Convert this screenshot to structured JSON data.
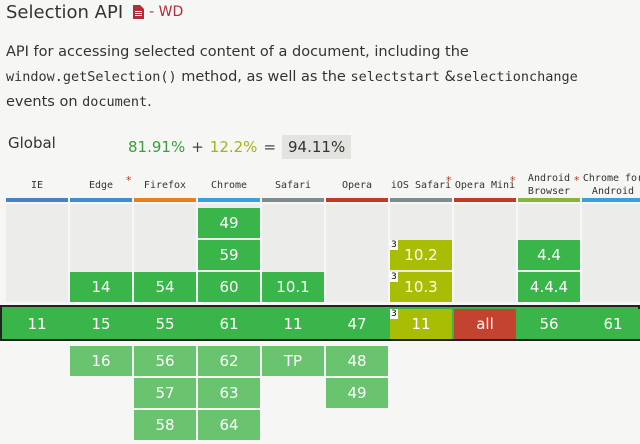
{
  "feature": {
    "title": "Selection API",
    "icon": "document-icon",
    "status": "- WD",
    "description": [
      {
        "text": "API for accessing selected content of a document, including the ",
        "code": false
      },
      {
        "text": "window.getSelection()",
        "code": true
      },
      {
        "text": " method, as well as the ",
        "code": false
      },
      {
        "text": "selectstart",
        "code": true
      },
      {
        "text": " &",
        "code": false
      },
      {
        "text": "selectionchange",
        "code": true
      },
      {
        "text": " events on ",
        "code": false
      },
      {
        "text": "document",
        "code": true
      },
      {
        "text": ".",
        "code": false
      }
    ]
  },
  "global": {
    "label": "Global",
    "full": "81.91%",
    "plus": "+",
    "partial": "12.2%",
    "equals": "=",
    "total": "94.11%"
  },
  "colors": {
    "supported": "#39b54a",
    "supported_future": "#6ac46f",
    "partial": "#a8bd04",
    "unsupported": "#c44230"
  },
  "browsers": [
    {
      "name": "IE",
      "bar": "#4a7fc1",
      "star": false,
      "cells": [
        {
          "row": 3,
          "v": "11",
          "s": "y"
        }
      ]
    },
    {
      "name": "Edge",
      "bar": "#3f8ccf",
      "star": true,
      "cells": [
        {
          "row": 2,
          "v": "14",
          "s": "y"
        },
        {
          "row": 3,
          "v": "15",
          "s": "y"
        },
        {
          "row": 4,
          "v": "16",
          "s": "yf"
        }
      ]
    },
    {
      "name": "Firefox",
      "bar": "#e67e22",
      "star": false,
      "cells": [
        {
          "row": 2,
          "v": "54",
          "s": "y"
        },
        {
          "row": 3,
          "v": "55",
          "s": "y"
        },
        {
          "row": 4,
          "v": "56",
          "s": "yf"
        },
        {
          "row": 5,
          "v": "57",
          "s": "yf"
        },
        {
          "row": 6,
          "v": "58",
          "s": "yf"
        }
      ]
    },
    {
      "name": "Chrome",
      "bar": "#3a9edb",
      "star": false,
      "cells": [
        {
          "row": 0,
          "v": "49",
          "s": "y"
        },
        {
          "row": 1,
          "v": "59",
          "s": "y"
        },
        {
          "row": 2,
          "v": "60",
          "s": "y"
        },
        {
          "row": 3,
          "v": "61",
          "s": "y"
        },
        {
          "row": 4,
          "v": "62",
          "s": "yf"
        },
        {
          "row": 5,
          "v": "63",
          "s": "yf"
        },
        {
          "row": 6,
          "v": "64",
          "s": "yf"
        }
      ]
    },
    {
      "name": "Safari",
      "bar": "#7f8c8d",
      "star": false,
      "cells": [
        {
          "row": 2,
          "v": "10.1",
          "s": "y"
        },
        {
          "row": 3,
          "v": "11",
          "s": "y"
        },
        {
          "row": 4,
          "v": "TP",
          "s": "yf"
        }
      ]
    },
    {
      "name": "Opera",
      "bar": "#c0392b",
      "star": false,
      "cells": [
        {
          "row": 3,
          "v": "47",
          "s": "y"
        },
        {
          "row": 4,
          "v": "48",
          "s": "yf"
        },
        {
          "row": 5,
          "v": "49",
          "s": "yf"
        }
      ]
    },
    {
      "name": "iOS Safari",
      "bar": "#7f8c8d",
      "star": true,
      "cells": [
        {
          "row": 1,
          "v": "10.2",
          "s": "a",
          "note": "3"
        },
        {
          "row": 2,
          "v": "10.3",
          "s": "a",
          "note": "3"
        },
        {
          "row": 3,
          "v": "11",
          "s": "a",
          "note": "3"
        }
      ]
    },
    {
      "name": "Opera Mini",
      "bar": "#c0392b",
      "star": true,
      "cells": [
        {
          "row": 3,
          "v": "all",
          "s": "n"
        }
      ]
    },
    {
      "name": "Android Browser",
      "bar": "#8ab33d",
      "star": true,
      "cells": [
        {
          "row": 1,
          "v": "4.4",
          "s": "y"
        },
        {
          "row": 2,
          "v": "4.4.4",
          "s": "y"
        },
        {
          "row": 3,
          "v": "56",
          "s": "y"
        }
      ]
    },
    {
      "name": "Chrome for Android",
      "bar": "#3a9edb",
      "star": false,
      "cells": [
        {
          "row": 3,
          "v": "61",
          "s": "y"
        }
      ]
    }
  ]
}
